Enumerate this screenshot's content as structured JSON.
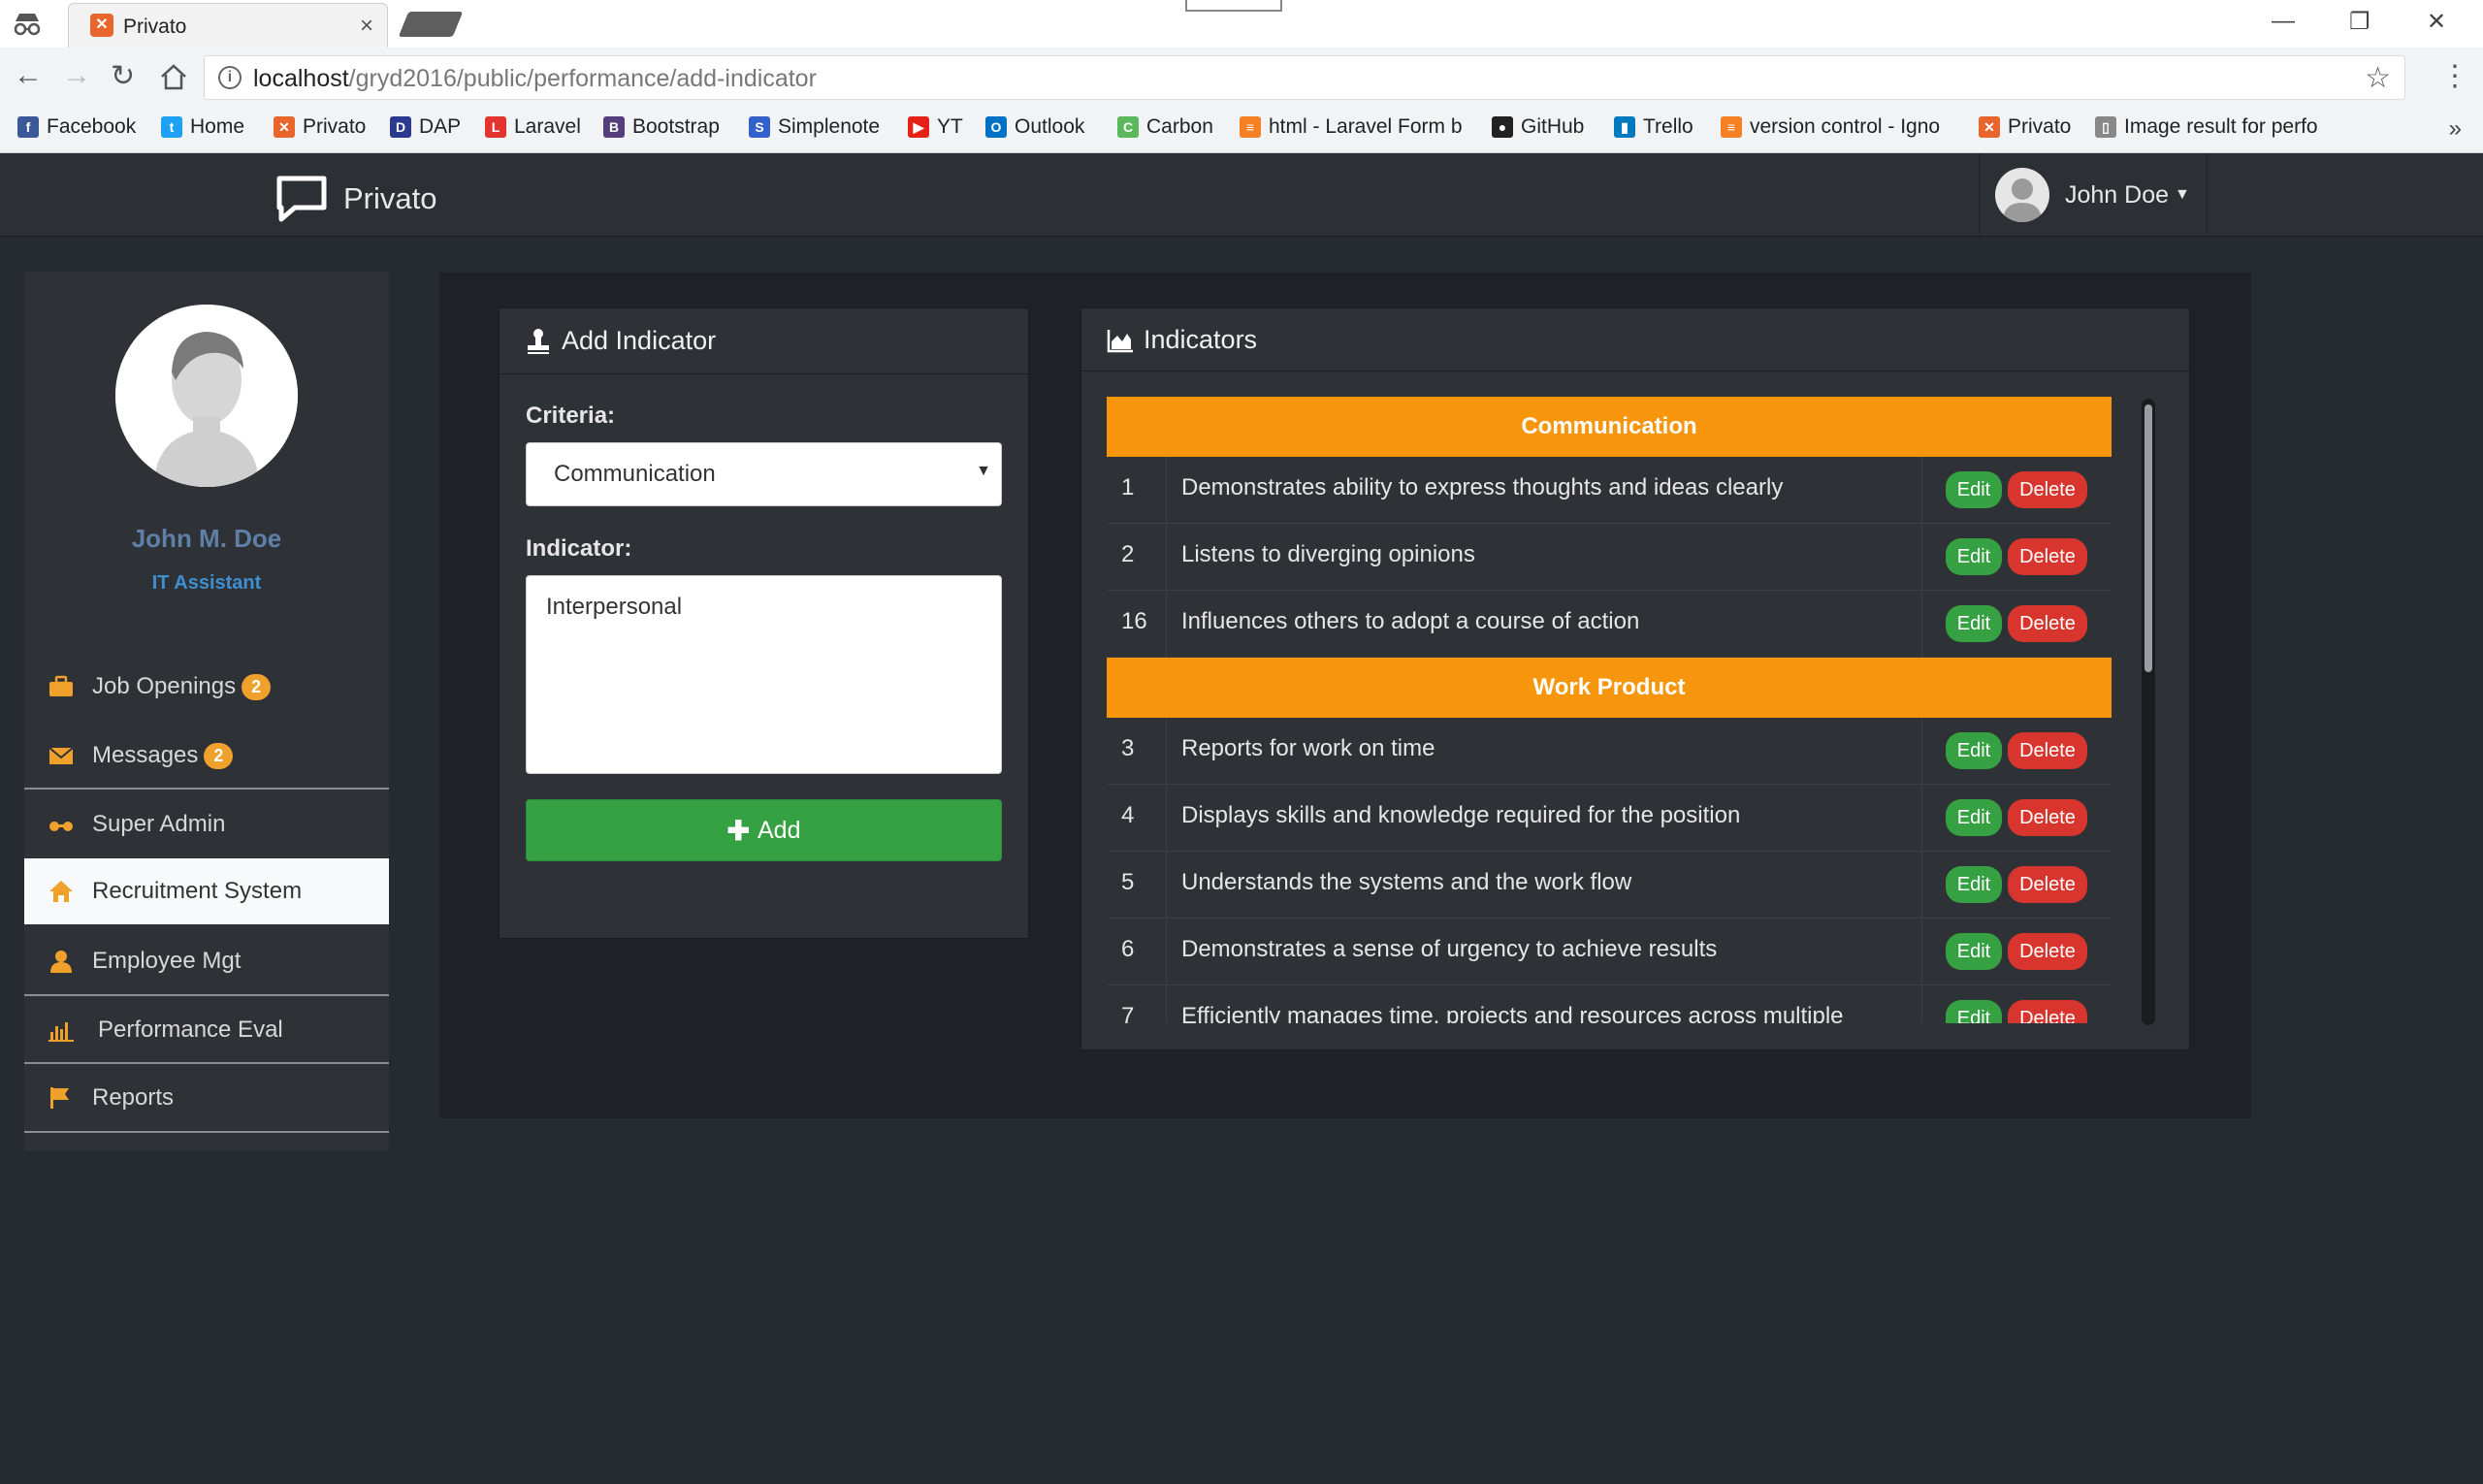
{
  "browser": {
    "tab_title": "Privato",
    "tab_close": "×",
    "url_host": "localhost",
    "url_path": "/gryd2016/public/performance/add-indicator",
    "bookmarks": [
      {
        "label": "Facebook",
        "icon": "facebook-icon",
        "color": "#3b5998"
      },
      {
        "label": "Home",
        "icon": "twitter-icon",
        "color": "#1da1f2"
      },
      {
        "label": "Privato",
        "icon": "xampp-icon",
        "color": "#e8652b"
      },
      {
        "label": "DAP",
        "icon": "dap-icon",
        "color": "#2b3a8f"
      },
      {
        "label": "Laravel",
        "icon": "laravel-icon",
        "color": "#e3342f"
      },
      {
        "label": "Bootstrap",
        "icon": "bootstrap-icon",
        "color": "#563d7c"
      },
      {
        "label": "Simplenote",
        "icon": "simplenote-icon",
        "color": "#3361cc"
      },
      {
        "label": "YT",
        "icon": "youtube-icon",
        "color": "#e62117"
      },
      {
        "label": "Outlook",
        "icon": "outlook-icon",
        "color": "#0072c6"
      },
      {
        "label": "Carbon",
        "icon": "carbon-icon",
        "color": "#5cb85c"
      },
      {
        "label": "html - Laravel Form b",
        "icon": "stackoverflow-icon",
        "color": "#f48024"
      },
      {
        "label": "GitHub",
        "icon": "github-icon",
        "color": "#222222"
      },
      {
        "label": "Trello",
        "icon": "trello-icon",
        "color": "#0079bf"
      },
      {
        "label": "version control - Igno",
        "icon": "stackoverflow-icon",
        "color": "#f48024"
      },
      {
        "label": "Privato",
        "icon": "xampp-icon",
        "color": "#e8652b"
      },
      {
        "label": "Image result for perfo",
        "icon": "page-icon",
        "color": "#888888"
      }
    ],
    "more": "»"
  },
  "app": {
    "brand": "Privato",
    "user": "John Doe"
  },
  "profile": {
    "name": "John M. Doe",
    "role": "IT Assistant"
  },
  "sidebar": {
    "items": [
      {
        "label": "Job Openings",
        "badge": "2",
        "icon": "briefcase-icon"
      },
      {
        "label": "Messages",
        "badge": "2",
        "icon": "envelope-icon"
      },
      {
        "label": "Super Admin",
        "icon": "glasses-icon"
      },
      {
        "label": "Recruitment System",
        "icon": "home-icon"
      },
      {
        "label": "Employee Mgt",
        "icon": "user-icon"
      },
      {
        "label": "Performance Eval",
        "icon": "bar-chart-icon"
      },
      {
        "label": "Reports",
        "icon": "flag-icon"
      }
    ]
  },
  "form": {
    "title": "Add Indicator",
    "criteria_label": "Criteria:",
    "criteria_value": "Communication",
    "indicator_label": "Indicator:",
    "indicator_value": "Interpersonal",
    "add_label": "Add"
  },
  "indicators": {
    "title": "Indicators",
    "edit_label": "Edit",
    "delete_label": "Delete",
    "groups": [
      {
        "name": "Communication",
        "rows": [
          {
            "num": "1",
            "text": "Demonstrates ability to express thoughts and ideas clearly"
          },
          {
            "num": "2",
            "text": "Listens to diverging opinions"
          },
          {
            "num": "16",
            "text": "Influences others to adopt a course of action"
          }
        ]
      },
      {
        "name": "Work Product",
        "rows": [
          {
            "num": "3",
            "text": "Reports for work on time"
          },
          {
            "num": "4",
            "text": "Displays skills and knowledge required for the position"
          },
          {
            "num": "5",
            "text": "Understands the systems and the work flow"
          },
          {
            "num": "6",
            "text": "Demonstrates a sense of urgency to achieve results"
          },
          {
            "num": "7",
            "text": "Efficiently manages time, projects and resources across multiple"
          }
        ]
      }
    ]
  },
  "colors": {
    "accent_orange": "#f7960d",
    "success_green": "#35a142",
    "danger_red": "#d9352f",
    "badge_orange": "#f0a12c"
  }
}
